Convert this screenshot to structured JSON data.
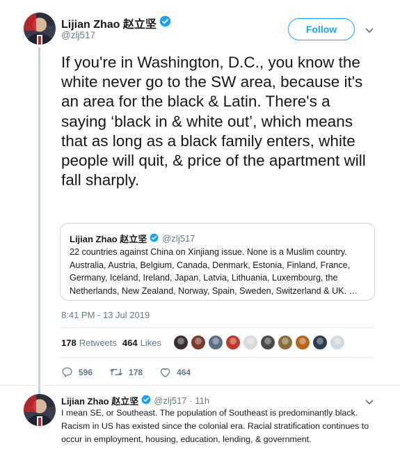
{
  "main_tweet": {
    "display_name": "Lijian Zhao 赵立坚",
    "handle": "@zlj517",
    "follow_label": "Follow",
    "text": "If you're in Washington, D.C., you know the white never go to the SW area, because it's an area for the black & Latin. There's a saying ‘black in & white out’, which means that as long as a black family enters, white people will quit, & price of the apartment will fall sharply.",
    "timestamp": "8:41 PM - 13 Jul 2019",
    "retweets_count": "178",
    "retweets_label": "Retweets",
    "likes_count": "464",
    "likes_label": "Likes",
    "liker_avatar_colors": [
      "#3b2f2f",
      "#7a3b2e",
      "#5a6e88",
      "#c0392b",
      "#d9d9d9",
      "#4a4a4a",
      "#8a6d3b",
      "#b5651d",
      "#2c3e50",
      "#cfd9de"
    ],
    "reply_count": "596",
    "retweet_action_count": "178",
    "like_action_count": "464"
  },
  "quoted_tweet": {
    "display_name": "Lijian Zhao 赵立坚",
    "handle": "@zlj517",
    "text": "22 countries against China on Xinjiang issue. None is a Muslim country. Australia, Austria, Belgium, Canada, Denmark, Estonia, Finland, France, Germany, Iceland, Ireland, Japan, Latvia, Lithuania, Luxembourg, the Netherlands, New Zealand, Norway, Spain, Sweden, Switzerland & UK. …"
  },
  "reply_tweet": {
    "display_name": "Lijian Zhao 赵立坚",
    "handle": "@zlj517",
    "time": "· 11h",
    "text": "I mean SE, or Southeast. The population of Southeast is predominantly black. Racism in US has existed since the colonial era. Racial stratification continues to occur in employment, housing, education, lending, & government."
  },
  "colors": {
    "accent": "#1da1f2",
    "secondary_text": "#657786",
    "thread_line": "#c4cfd6",
    "border": "#ccd6dd"
  }
}
